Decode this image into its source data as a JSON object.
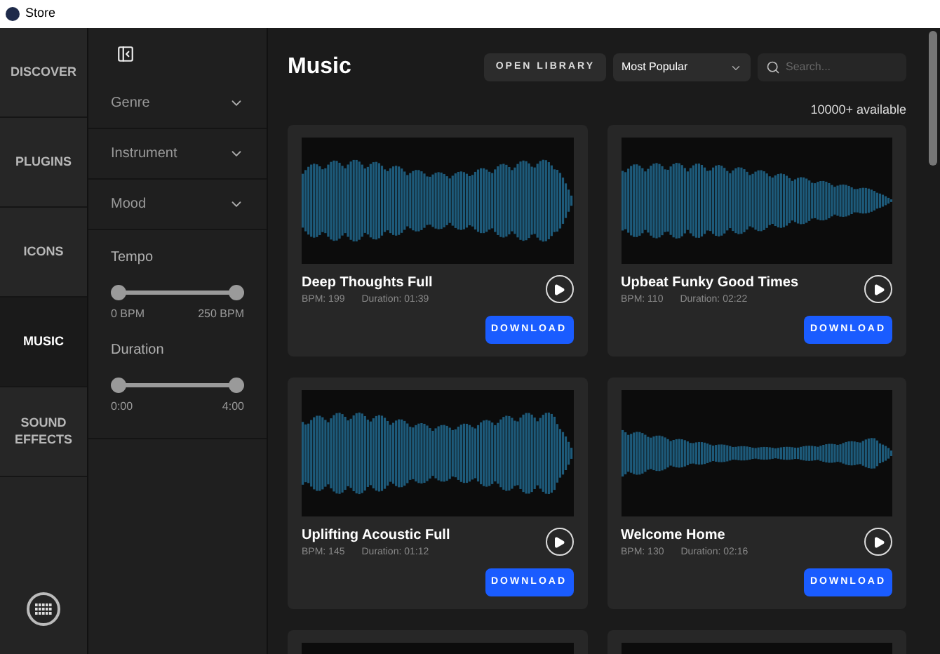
{
  "window": {
    "title": "Store"
  },
  "nav": [
    {
      "label": "DISCOVER",
      "selected": false
    },
    {
      "label": "PLUGINS",
      "selected": false
    },
    {
      "label": "ICONS",
      "selected": false
    },
    {
      "label": "MUSIC",
      "selected": true
    },
    {
      "label": "SOUND EFFECTS",
      "selected": false
    }
  ],
  "filters": {
    "sections": [
      {
        "label": "Genre",
        "expanded": false
      },
      {
        "label": "Instrument",
        "expanded": false
      },
      {
        "label": "Mood",
        "expanded": false
      }
    ],
    "ranges": [
      {
        "label": "Tempo",
        "thumbs": [
          {
            "level": 0
          },
          {
            "level": 1
          }
        ],
        "min_label": "0 BPM",
        "max_label": "250 BPM"
      },
      {
        "label": "Duration",
        "thumbs": [
          {
            "level": 0
          },
          {
            "level": 1
          }
        ],
        "min_label": "0:00",
        "max_label": "4:00"
      }
    ]
  },
  "main": {
    "title": "Music",
    "open_library": "OPEN LIBRARY",
    "sort": {
      "value": "Most Popular"
    },
    "search": {
      "placeholder": "Search..."
    },
    "available": "10000+ available",
    "tracks": [
      {
        "title": "Deep Thoughts Full",
        "bpm": "BPM: 199",
        "duration": "Duration: 01:39",
        "download": "DOWNLOAD"
      },
      {
        "title": "Upbeat Funky Good Times",
        "bpm": "BPM: 110",
        "duration": "Duration: 02:22",
        "download": "DOWNLOAD"
      },
      {
        "title": "Uplifting Acoustic Full",
        "bpm": "BPM: 145",
        "duration": "Duration: 01:12",
        "download": "DOWNLOAD"
      },
      {
        "title": "Welcome Home",
        "bpm": "BPM: 130",
        "duration": "Duration: 02:16",
        "download": "DOWNLOAD"
      }
    ]
  }
}
